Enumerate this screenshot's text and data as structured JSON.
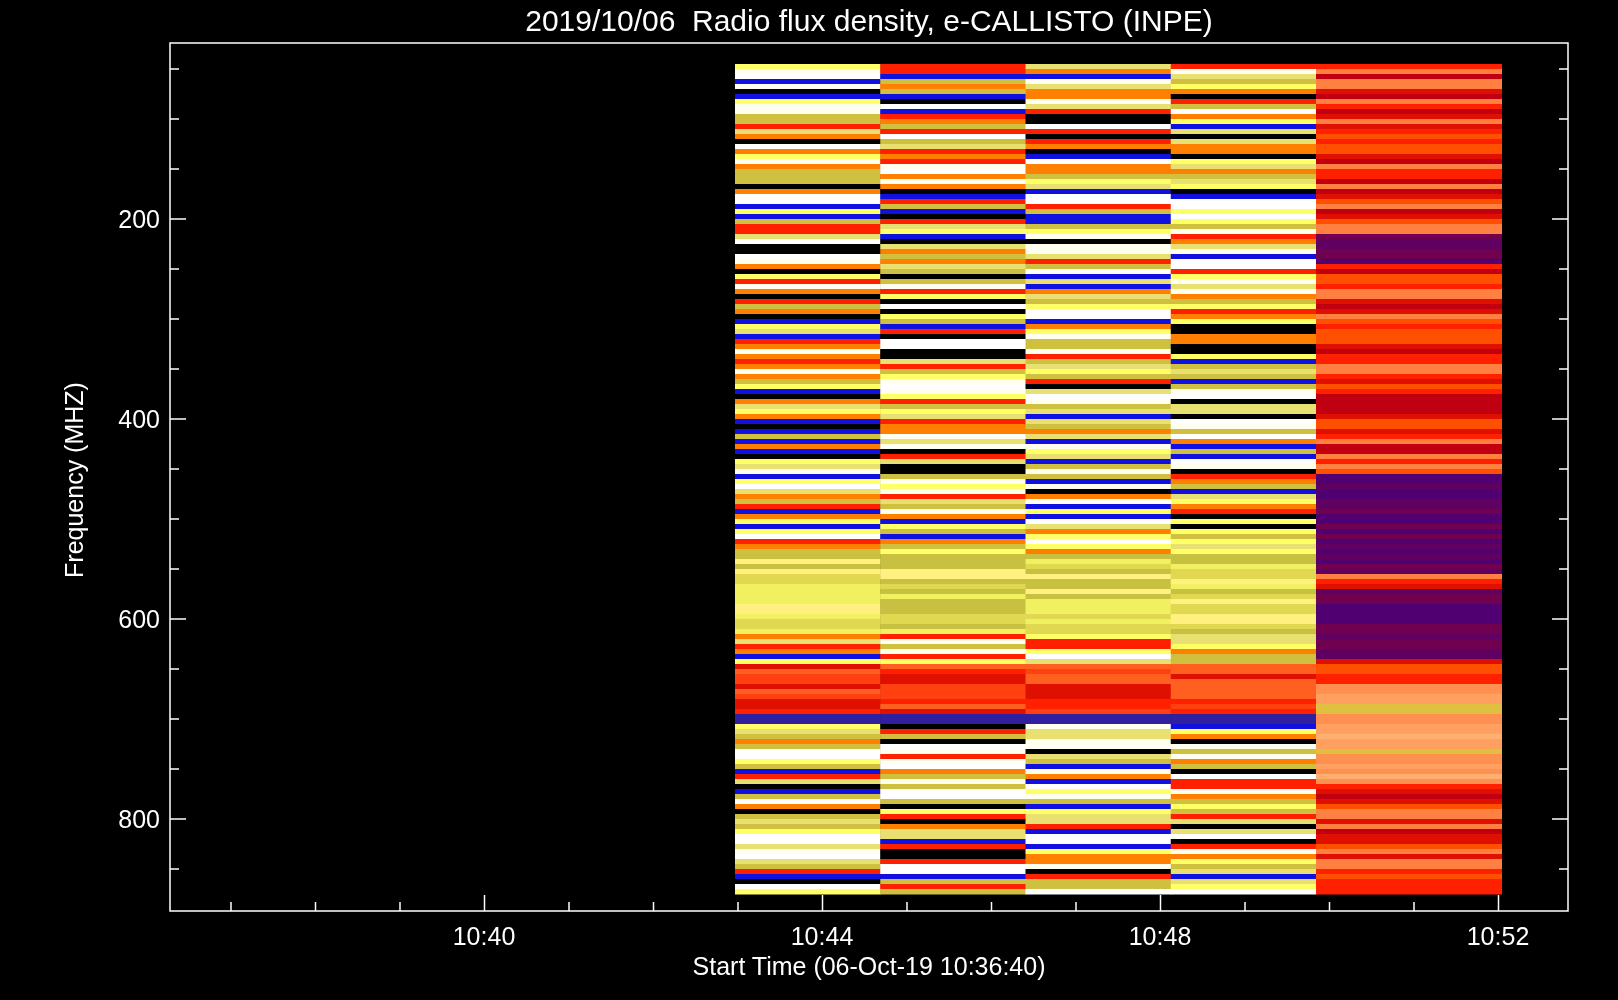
{
  "plot": {
    "title": "2019/10/06  Radio flux density, e-CALLISTO (INPE)",
    "ylabel": "Frequency (MHZ)",
    "xlabel": "Start Time (06-Oct-19 10:36:40)",
    "yticks": [
      "200",
      "400",
      "600",
      "800"
    ],
    "xticks": [
      "10:40",
      "10:44",
      "10:48",
      "10:52"
    ]
  }
}
